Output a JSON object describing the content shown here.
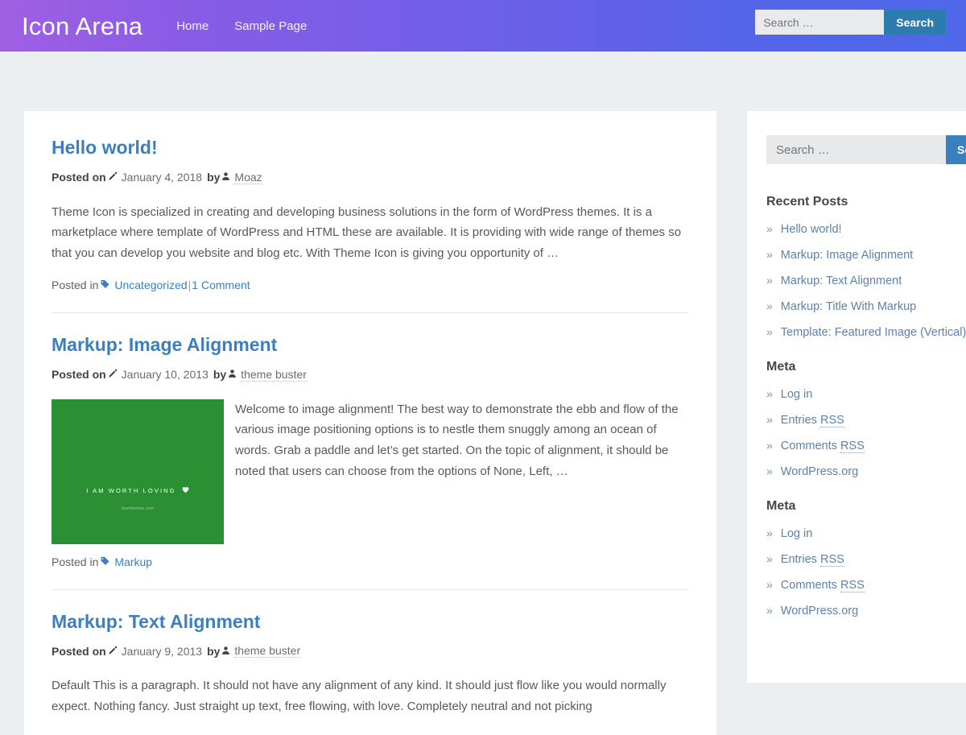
{
  "header": {
    "site_title": "Icon Arena",
    "nav": [
      {
        "label": "Home"
      },
      {
        "label": "Sample Page"
      }
    ],
    "search": {
      "placeholder": "Search …",
      "value": "",
      "button_label": "Search"
    },
    "gradient_from": "#a05fe3",
    "gradient_to": "#4f68ea"
  },
  "colors": {
    "page_background": "#eceff1",
    "card_background": "#ffffff",
    "link": "#3c7fbf",
    "sidebar_link": "#5c82ab",
    "search_button": "#3a80bf",
    "header_search_button": "#2d7cb0",
    "featured_image": "#2b9033"
  },
  "posts": [
    {
      "title": "Hello world!",
      "meta": {
        "posted_on_label": "Posted on",
        "date_icon": "pencil-icon",
        "date": "January 4, 2018",
        "by_label": "by",
        "author_icon": "user-icon",
        "author": "Moaz"
      },
      "body": "Theme Icon is specialized in creating and developing business solutions in the form of WordPress themes. It is a marketplace where template of WordPress and HTML these are available. It is providing with wide range of themes so that you can develop you website and blog etc. With Theme Icon is giving you opportunity of …",
      "footer": {
        "posted_in_label": "Posted in",
        "tag_icon": "tag-icon",
        "category": "Uncategorized",
        "separator": "|",
        "comments": "1 Comment"
      },
      "has_image": false
    },
    {
      "title": "Markup: Image Alignment",
      "meta": {
        "posted_on_label": "Posted on",
        "date_icon": "pencil-icon",
        "date": "January 10, 2013",
        "by_label": "by",
        "author_icon": "user-icon",
        "author": "theme buster"
      },
      "body": "Welcome to image alignment! The best way to demonstrate the ebb and flow of the various image positioning options is to nestle them snuggly among an ocean of words. Grab a paddle and let’s get started. On the topic of alignment, it should be noted that users can choose from the options of None, Left, …",
      "footer": {
        "posted_in_label": "Posted in",
        "tag_icon": "tag-icon",
        "category": "Markup",
        "separator": "",
        "comments": ""
      },
      "has_image": true,
      "image": {
        "caption": "I AM WORTH LOVING",
        "icon": "heart-icon",
        "watermark": "lovethemes.com",
        "background": "#2b9033"
      }
    },
    {
      "title": "Markup: Text Alignment",
      "meta": {
        "posted_on_label": "Posted on",
        "date_icon": "pencil-icon",
        "date": "January 9, 2013",
        "by_label": "by",
        "author_icon": "user-icon",
        "author": "theme buster"
      },
      "body": "Default This is a paragraph. It should not have any alignment of any kind. It should just flow like you would normally expect. Nothing fancy. Just straight up text, free flowing, with love. Completely neutral and not picking",
      "has_image": false
    }
  ],
  "sidebar": {
    "search": {
      "placeholder": "Search …",
      "value": "",
      "button_label": "Search"
    },
    "recent_posts": {
      "title": "Recent Posts",
      "items": [
        {
          "label": "Hello world!"
        },
        {
          "label": "Markup: Image Alignment"
        },
        {
          "label": "Markup: Text Alignment"
        },
        {
          "label": "Markup: Title With Markup"
        },
        {
          "label": "Template: Featured Image (Vertical)"
        }
      ]
    },
    "meta_one": {
      "title": "Meta",
      "items": [
        {
          "label": "Log in",
          "abbr": ""
        },
        {
          "label": "Entries ",
          "abbr": "RSS"
        },
        {
          "label": "Comments ",
          "abbr": "RSS"
        },
        {
          "label": "WordPress.org",
          "abbr": ""
        }
      ]
    },
    "meta_two": {
      "title": "Meta",
      "items": [
        {
          "label": "Log in",
          "abbr": ""
        },
        {
          "label": "Entries ",
          "abbr": "RSS"
        },
        {
          "label": "Comments ",
          "abbr": "RSS"
        },
        {
          "label": "WordPress.org",
          "abbr": ""
        }
      ]
    },
    "chevron": "»"
  }
}
